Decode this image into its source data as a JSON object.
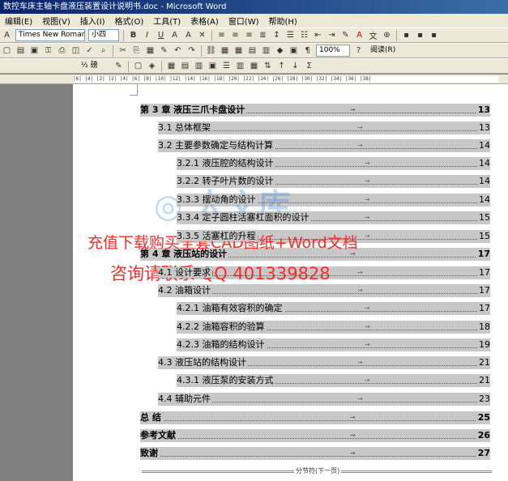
{
  "window": {
    "title": "数控车床主轴卡盘液压装置设计说明书.doc - Microsoft Word"
  },
  "menu": [
    "编辑(E)",
    "视图(V)",
    "插入(I)",
    "格式(O)",
    "工具(T)",
    "表格(A)",
    "窗口(W)",
    "帮助(H)"
  ],
  "format_toolbar": {
    "font": "Times New Roman",
    "size": "小四"
  },
  "toolbar2": {
    "zoom": "100%",
    "read_label": "阅读(R)"
  },
  "toolbar3": {
    "linestyle": "½ 磅"
  },
  "ruler": {
    "text": "|6| |4| |2| |2| |4| |6| |8| |10| |12| |14| |16| |18| |20| |22| |24| |26| |28| |30| |32| |34| |36| |38|"
  },
  "toc": [
    {
      "text": "第 3 章  液压三爪卡盘设计",
      "page": "13",
      "bold": true
    },
    {
      "text": "3.1  总体框架",
      "page": "13"
    },
    {
      "text": "3.2  主要参数确定与结构计算",
      "page": "14"
    },
    {
      "text": "3.2.1  液压腔的结构设计",
      "page": "14"
    },
    {
      "text": "3.2.2  转子叶片数的设计",
      "page": "14"
    },
    {
      "text": "3.3.3  摆动角的设计",
      "page": "14"
    },
    {
      "text": "3.3.4  定子圆柱活塞杠面积的设计",
      "page": "15"
    },
    {
      "text": "3.3.5  活塞杠的升程",
      "page": "15"
    },
    {
      "text": "第 4 章  液压站的设计",
      "page": "17",
      "bold": true
    },
    {
      "text": "4.1  设计要求",
      "page": "17"
    },
    {
      "text": "4.2  油箱设计",
      "page": "17"
    },
    {
      "text": "4.2.1 油箱有效容积的确定",
      "page": "17"
    },
    {
      "text": "4.2.2  油箱容积的验算",
      "page": "18"
    },
    {
      "text": "4.2.3  油箱的结构设计",
      "page": "19"
    },
    {
      "text": "4.3  液压站的结构设计",
      "page": "21"
    },
    {
      "text": "4.3.1  液压泵的安装方式",
      "page": "21"
    },
    {
      "text": "4.4  辅助元件",
      "page": "23"
    },
    {
      "text": "总  结",
      "page": "25",
      "bold": true
    },
    {
      "text": "参考文献",
      "page": "26",
      "bold": true
    },
    {
      "text": "致谢",
      "page": "27",
      "bold": true
    }
  ],
  "watermark": {
    "line1": "充值下载购买全套CAD图纸+Word文档",
    "line2": "咨询请联系  QQ 401339828"
  },
  "section_break": "分节符(下一页)"
}
